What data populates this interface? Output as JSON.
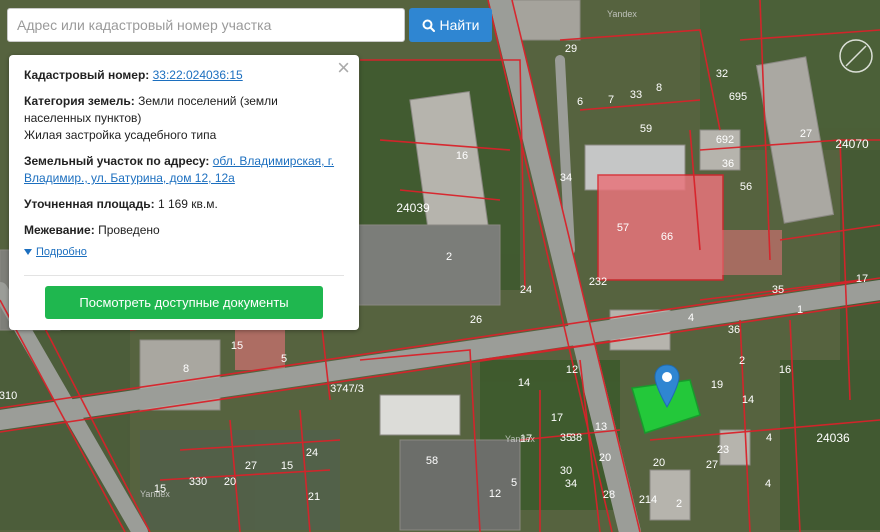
{
  "search": {
    "placeholder": "Адрес или кадастровый номер участка",
    "button_label": "Найти",
    "button_icon": "search-icon"
  },
  "info": {
    "cadastral_label": "Кадастровый номер:",
    "cadastral_value": "33:22:024036:15",
    "category_label": "Категория земель:",
    "category_value": "Земли поселений (земли населенных пунктов)",
    "category_value2": "Жилая застройка усадебного типа",
    "address_label": "Земельный участок по адресу:",
    "address_value": "обл. Владимирская, г. Владимир., ул. Батурина, дом 12, 12а",
    "area_label": "Уточненная площадь:",
    "area_value": "1 169 кв.м.",
    "survey_label": "Межевание:",
    "survey_value": "Проведено",
    "more_label": "Подробно",
    "docs_button": "Посмотреть доступные документы",
    "close": "×"
  },
  "map": {
    "watermark": "Yandex",
    "labels": [
      "29",
      "32",
      "24070",
      "695",
      "27",
      "6",
      "33",
      "7",
      "8",
      "692",
      "56",
      "59",
      "36",
      "24039",
      "16",
      "57",
      "66",
      "2",
      "24",
      "17",
      "35",
      "232",
      "34",
      "1",
      "4",
      "5",
      "26",
      "15",
      "29",
      "36",
      "2",
      "16",
      "3747/3",
      "8",
      "310",
      "14",
      "27",
      "15",
      "17",
      "19",
      "14",
      "12",
      "38",
      "17",
      "13",
      "35",
      "4",
      "20",
      "24036",
      "23",
      "20",
      "27",
      "24",
      "4",
      "58",
      "30",
      "5",
      "34",
      "330",
      "20",
      "28",
      "2",
      "214",
      "15",
      "21",
      "12"
    ],
    "colors": {
      "parcel_line": "#d9222a",
      "selected_parcel": "#1ed43a",
      "highlight_building": "#e8747c",
      "marker": "#2f86d2"
    }
  }
}
